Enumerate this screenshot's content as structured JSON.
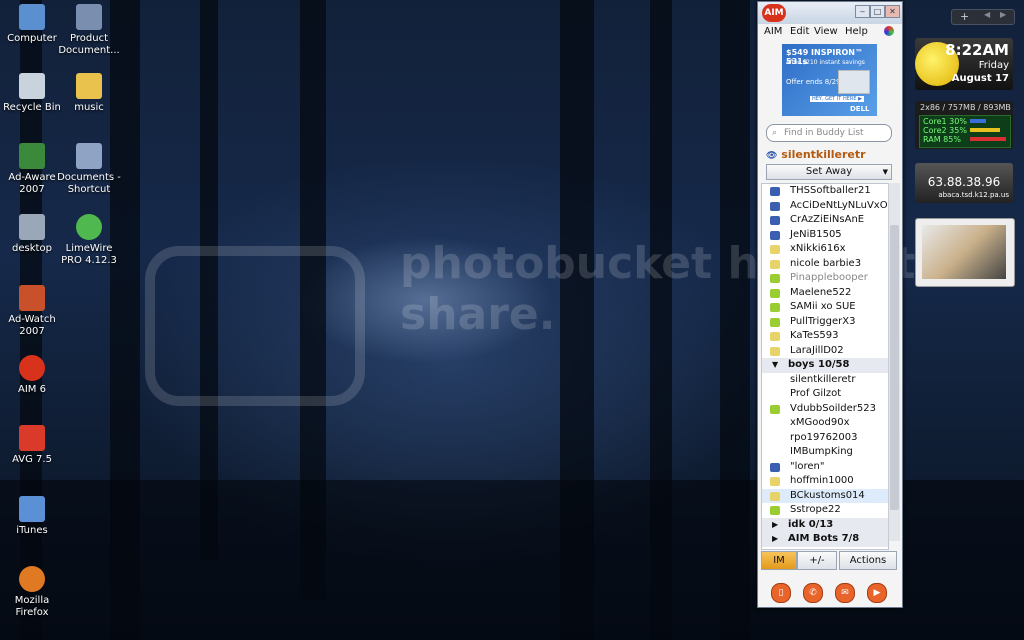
{
  "desktop_icons": [
    {
      "label": "Computer",
      "icon": "computer-icon",
      "color": "#5a8fd0"
    },
    {
      "label": "Product Document...",
      "icon": "document-shortcut-icon",
      "color": "#7a8fb0"
    },
    {
      "label": "Recycle Bin",
      "icon": "recycle-bin-icon",
      "color": "#c9d3de"
    },
    {
      "label": "music",
      "icon": "folder-icon",
      "color": "#e8c24c"
    },
    {
      "label": "Ad-Aware 2007",
      "icon": "ad-aware-icon",
      "color": "#3b8a3b"
    },
    {
      "label": "Documents - Shortcut",
      "icon": "documents-shortcut-icon",
      "color": "#8fa4c4"
    },
    {
      "label": "desktop",
      "icon": "desktop-shortcut-icon",
      "color": "#9aa7b8"
    },
    {
      "label": "LimeWire PRO 4.12.3",
      "icon": "limewire-icon",
      "color": "#4fb84f"
    },
    {
      "label": "Ad-Watch 2007",
      "icon": "ad-watch-icon",
      "color": "#c8502a"
    },
    {
      "label": "AIM 6",
      "icon": "aim-icon",
      "color": "#d9321c"
    },
    {
      "label": "AVG 7.5",
      "icon": "avg-icon",
      "color": "#d93a2a"
    },
    {
      "label": "iTunes",
      "icon": "itunes-icon",
      "color": "#5b8fd6"
    },
    {
      "label": "Mozilla Firefox",
      "icon": "firefox-icon",
      "color": "#e07a22"
    }
  ],
  "aim": {
    "logo": "AIM",
    "menus": [
      "AIM",
      "Edit",
      "View",
      "Help"
    ],
    "ad": {
      "line1": "$549 INSPIRON™ 531s",
      "line2": "After $210 instant savings",
      "line3": "Offer ends 8/29",
      "cta": "HEY, GET IT HERE ▶",
      "brand": "DELL"
    },
    "search_placeholder": "Find in Buddy List",
    "screen_name": "silentkilleretr",
    "away_label": "Set Away",
    "buddies": [
      {
        "name": "THSSoftballer21",
        "status": "mobile",
        "type": "buddy"
      },
      {
        "name": "AcCiDeNtLyNLuVxO",
        "status": "mobile",
        "type": "buddy"
      },
      {
        "name": "CrAzZiEiNsAnE",
        "status": "mobile",
        "type": "buddy"
      },
      {
        "name": "JeNiB1505",
        "status": "mobile",
        "type": "buddy"
      },
      {
        "name": "xNikki616x",
        "status": "away",
        "type": "buddy"
      },
      {
        "name": "nicole barbie3",
        "status": "away",
        "type": "buddy"
      },
      {
        "name": "Pinapplebooper",
        "status": "idle",
        "type": "buddy"
      },
      {
        "name": "Maelene522",
        "status": "idle",
        "type": "buddy"
      },
      {
        "name": "SAMii xo SUE",
        "status": "idle",
        "type": "buddy"
      },
      {
        "name": "PullTriggerX3",
        "status": "idle",
        "type": "buddy"
      },
      {
        "name": "KaTeS593",
        "status": "away",
        "type": "buddy"
      },
      {
        "name": "LaraJillD02",
        "status": "away",
        "type": "buddy"
      },
      {
        "name": "boys 10/58",
        "status": "",
        "type": "group-open"
      },
      {
        "name": "silentkilleretr",
        "status": "",
        "type": "buddy"
      },
      {
        "name": "Prof Gilzot",
        "status": "",
        "type": "buddy"
      },
      {
        "name": "VdubbSoilder523",
        "status": "idle",
        "type": "buddy"
      },
      {
        "name": "xMGood90x",
        "status": "",
        "type": "buddy"
      },
      {
        "name": "rpo19762003",
        "status": "",
        "type": "buddy"
      },
      {
        "name": "IMBumpKing",
        "status": "",
        "type": "buddy"
      },
      {
        "name": "\"loren\"",
        "status": "mobile",
        "type": "buddy"
      },
      {
        "name": "hoffmin1000",
        "status": "away",
        "type": "buddy"
      },
      {
        "name": "BCkustoms014",
        "status": "away",
        "type": "buddy-selected"
      },
      {
        "name": "Sstrope22",
        "status": "idle",
        "type": "buddy"
      },
      {
        "name": "idk 0/13",
        "status": "",
        "type": "group-closed"
      },
      {
        "name": "AIM Bots 7/8",
        "status": "",
        "type": "group-closed"
      }
    ],
    "bottom_buttons": {
      "im": "IM",
      "add": "+/-",
      "actions": "Actions"
    },
    "status_colors": {
      "mobile": "#3a5fb0",
      "away": "#e8d36a",
      "idle": "#9acd32"
    }
  },
  "gadgets": {
    "clock": {
      "time": "8:22AM",
      "day": "Friday",
      "date": "August 17"
    },
    "cpu": {
      "header": "2x86 / 757MB / 893MB",
      "rows": [
        {
          "label": "Core1",
          "value": "30%"
        },
        {
          "label": "Core2",
          "value": "35%"
        },
        {
          "label": "RAM",
          "value": "85%"
        }
      ]
    },
    "ip": {
      "address": "63.88.38.96",
      "host": "abaca.tsd.k12.pa.us"
    }
  },
  "watermark": "photobucket host. store. share."
}
